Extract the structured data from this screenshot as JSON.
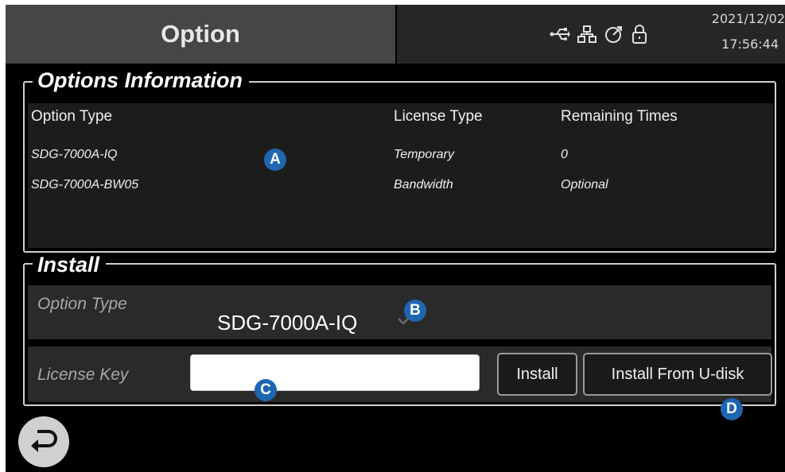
{
  "header": {
    "title": "Option",
    "status_icons": [
      "usb-icon",
      "network-icon",
      "external-clock-icon",
      "lock-icon"
    ],
    "date": "2021/12/02",
    "time": "17:56:44"
  },
  "options_information": {
    "legend": "Options Information",
    "columns": [
      "Option Type",
      "License Type",
      "Remaining Times"
    ],
    "rows": [
      {
        "option_type": "SDG-7000A-IQ",
        "license_type": "Temporary",
        "remaining": "0"
      },
      {
        "option_type": "SDG-7000A-BW05",
        "license_type": "Bandwidth",
        "remaining": "Optional"
      }
    ]
  },
  "install": {
    "legend": "Install",
    "option_type_label": "Option Type",
    "option_type_value": "SDG-7000A-IQ",
    "license_key_label": "License Key",
    "license_key_value": "",
    "install_button": "Install",
    "install_udisk_button": "Install From U-disk"
  },
  "markers": {
    "a": "A",
    "b": "B",
    "c": "C",
    "d": "D"
  },
  "colors": {
    "title_bg": "#464646",
    "status_bg": "#262626",
    "panel_bg": "#1c1c1c",
    "row_bg": "#2a2a2a",
    "marker": "#1f66b0"
  }
}
